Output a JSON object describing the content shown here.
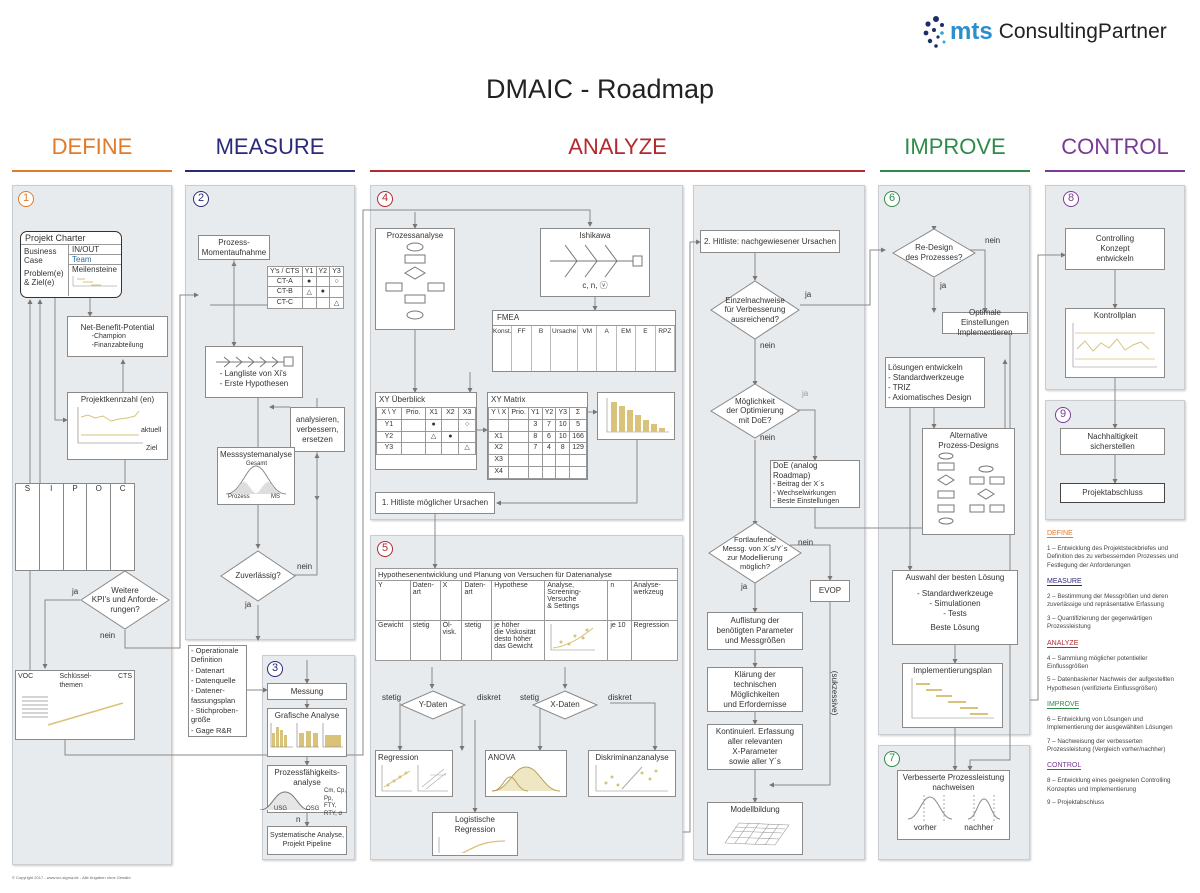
{
  "logo": {
    "brand": "mts",
    "name": "ConsultingPartner"
  },
  "title": "DMAIC - Roadmap",
  "phases": {
    "define": "DEFINE",
    "measure": "MEASURE",
    "analyze": "ANALYZE",
    "improve": "IMPROVE",
    "control": "CONTROL"
  },
  "colors": {
    "define": "#e07b2a",
    "measure": "#2b2a7a",
    "analyze": "#b22a2f",
    "improve": "#2e8b4a",
    "control": "#7b3a96",
    "gold": "#d9c27a"
  },
  "steps": [
    "1",
    "2",
    "3",
    "4",
    "5",
    "6",
    "7",
    "8",
    "9"
  ],
  "define": {
    "charter": {
      "title": "Projekt Charter",
      "business": "Business\nCase",
      "inout": "IN/OUT",
      "team": "Team",
      "problem": "Problem(e)\n& Ziel(e)",
      "milestones": "Meilensteine"
    },
    "net_benefit": {
      "title": "Net-Benefit-Potential",
      "lines": "-Champion\n-Finanzabteilung"
    },
    "kpi": {
      "title": "Projektkennzahl (en)",
      "actual": "aktuell",
      "target": "Ziel"
    },
    "sipoc": [
      "S",
      "I",
      "P",
      "O",
      "C"
    ],
    "decision": "Weitere\nKPI's und Anforde-\nrungen?",
    "yes": "ja",
    "no": "nein",
    "voc": {
      "voc": "VOC",
      "key": "Schlüssel-\nthemen",
      "cts": "CTS"
    }
  },
  "measure": {
    "snapshot": "Prozess-\nMomentaufnahme",
    "cts_table": {
      "header": [
        "Y's / CTS",
        "Y1",
        "Y2",
        "Y3"
      ],
      "rows": [
        [
          "CT-A",
          "●",
          "",
          "○"
        ],
        [
          "CT-B",
          "△",
          "●",
          ""
        ],
        [
          "CT-C",
          "",
          "",
          "△"
        ]
      ]
    },
    "longlist": "-  Langliste von Xi's\n-  Erste Hypothesen",
    "improve_msa": "analysieren,\nverbessern,\nersetzen",
    "msa": {
      "title": "Messsystemanalyse",
      "total": "Gesamt",
      "process": "Prozess",
      "ms": "MS"
    },
    "decision": "Zuverlässig?",
    "yes": "ja",
    "no": "nein",
    "checklist": [
      "Operationale Definition",
      "Datenart",
      "Datenquelle",
      "Datener-fassungsplan",
      "Stichproben-größe",
      "Gage R&R"
    ],
    "measurement": "Messung",
    "graphic": "Grafische Analyse",
    "capability": {
      "title": "Prozessfähigkeits-\nanalyse",
      "lsl": "USG",
      "usl": "OSG",
      "metrics": "Cm, Cp,\nPp, FTY,\nRTY, σ",
      "n": "n"
    },
    "pipeline": "Systematische Analyse,\nProjekt Pipeline"
  },
  "analyze": {
    "process_analysis": "Prozessanalyse",
    "ishikawa": {
      "title": "Ishikawa",
      "labels": "c, n, ⓥ"
    },
    "fmea": {
      "title": "FMEA",
      "columns": [
        "Konst.",
        "FF",
        "B",
        "Ursache",
        "VM",
        "A",
        "EM",
        "E",
        "RPZ"
      ]
    },
    "xy_overview": {
      "title": "XY Überblick",
      "header": [
        "X \\ Y",
        "Prio.",
        "X1",
        "X2",
        "X3"
      ],
      "rows": [
        [
          "Y1",
          "",
          "●",
          "",
          "○"
        ],
        [
          "Y2",
          "",
          "△",
          "●",
          ""
        ],
        [
          "Y3",
          "",
          "",
          "",
          "△"
        ]
      ]
    },
    "xy_matrix": {
      "title": "XY Matrix",
      "header": [
        "Y \\ X",
        "Prio.",
        "Y1",
        "Y2",
        "Y3",
        "Σ"
      ],
      "weights": [
        "",
        "",
        "3",
        "7",
        "10",
        "5"
      ],
      "rows": [
        [
          "X1",
          "",
          "8",
          "6",
          "10",
          "166"
        ],
        [
          "X2",
          "",
          "7",
          "4",
          "8",
          "129"
        ],
        [
          "X3",
          "",
          "",
          "",
          "",
          ""
        ],
        [
          "X4",
          "",
          "",
          "",
          "",
          ""
        ]
      ]
    },
    "hitlist1": "1. Hitliste möglicher Ursachen",
    "hypothesis": {
      "title": "Hypothesenentwicklung und Planung von Versuchen für Datenanalyse",
      "header": [
        "Y",
        "Daten-\nart",
        "X",
        "Daten-\nart",
        "Hypothese",
        "Analyse,\nScreening-\nVersuche\n& Settings",
        "n",
        "Analyse-\nwerkzeug"
      ],
      "row": [
        "Gewicht",
        "stetig",
        "Öl-\nvisk.",
        "stetig",
        "je höher\ndie Viskosität\ndesto  höher\ndas Gewicht",
        "",
        "je 10",
        "Regression"
      ]
    },
    "y_data": "Y-Daten",
    "x_data": "X-Daten",
    "continuous": "stetig",
    "discrete": "diskret",
    "regression": "Regression",
    "anova": "ANOVA",
    "discriminant": "Diskriminanzanalyse",
    "logistic": "Logistische Regression",
    "hitlist2": "2. Hitliste: nachgewiesener Ursachen",
    "single_proof": "Einzelnachweise\nfür Verbesserung\nausreichend?",
    "doe_possible": "Möglichkeit\nder Optimierung\nmit DoE?",
    "doe": {
      "title": "DoE (analog Roadmap)",
      "lines": "- Beitrag der X´s\n- Wechselwirkungen\n- Beste Einstellungen"
    },
    "continuous_meas": "Fortlaufende\nMessg. von X´s/Y´s\nzur Modellierung\nmöglich?",
    "evop": "EVOP",
    "successive": "(sukzessive)",
    "params": "Auflistung der\nbenötigten Parameter\nund Messgrößen",
    "clarify": "Klärung der\ntechnischen Möglichkeiten\nund Erfordernisse",
    "continuous_capture": "Kontinuierl. Erfassung\naller relevanten\nX-Parameter\nsowie aller Y´s",
    "modelling": "Modellbildung",
    "yes": "ja",
    "no": "nein"
  },
  "improve": {
    "redesign": "Re-Design\ndes Prozesses?",
    "yes": "ja",
    "no": "nein",
    "optimal": "Optimale Einstellungen\nImplementieren",
    "develop": {
      "title": "Lösungen entwickeln",
      "lines": "- Standardwerkzeuge\n- TRIZ\n- Axiomatisches Design"
    },
    "alternatives": "Alternative\nProzess-Designs",
    "select": {
      "title": "Auswahl der besten Lösung",
      "lines": "- Standardwerkzeuge\n- Simulationen\n- Tests",
      "best": "Beste Lösung"
    },
    "plan": "Implementierungsplan",
    "verified": {
      "title": "Verbesserte Prozessleistung\nnachweisen",
      "before": "vorher",
      "after": "nachher"
    }
  },
  "control": {
    "concept": "Controlling\nKonzept\nentwickeln",
    "plan": "Kontrollplan",
    "sustain": "Nachhaltigkeit\nsicherstellen",
    "close": "Projektabschluss"
  },
  "legend": [
    {
      "heading": "DEFINE",
      "items": [
        "1 – Entwicklung des Projektsteckbriefes und Definition des zu verbessernden Prozesses und Festlegung der Anforderungen"
      ]
    },
    {
      "heading": "MEASURE",
      "items": [
        "2 – Bestimmung der Messgrößen und deren zuverlässige und repräsentative Erfassung",
        "3 – Quantifizierung der gegenwärtigen Prozessleistung"
      ]
    },
    {
      "heading": "ANALYZE",
      "items": [
        "4 – Sammlung möglicher potentieller Einflussgrößen",
        "5 – Datenbasierter Nachweis der aufgestellten Hypothesen (verifizierte Einflussgrößen)"
      ]
    },
    {
      "heading": "IMPROVE",
      "items": [
        "6 – Entwicklung von Lösungen und Implementierung der ausgewählten Lösungen",
        "7 – Nachweisung der verbesserten Prozessleistung (Vergleich vorher/nachher)"
      ]
    },
    {
      "heading": "CONTROL",
      "items": [
        "8 – Entwicklung eines geeigneten Controlling Konzeptes und Implementierung",
        "9 – Projektabschluss"
      ]
    }
  ],
  "footer": "© Copyright 2017 - www.six-sigma.de - Alle Angaben ohne Gewähr"
}
